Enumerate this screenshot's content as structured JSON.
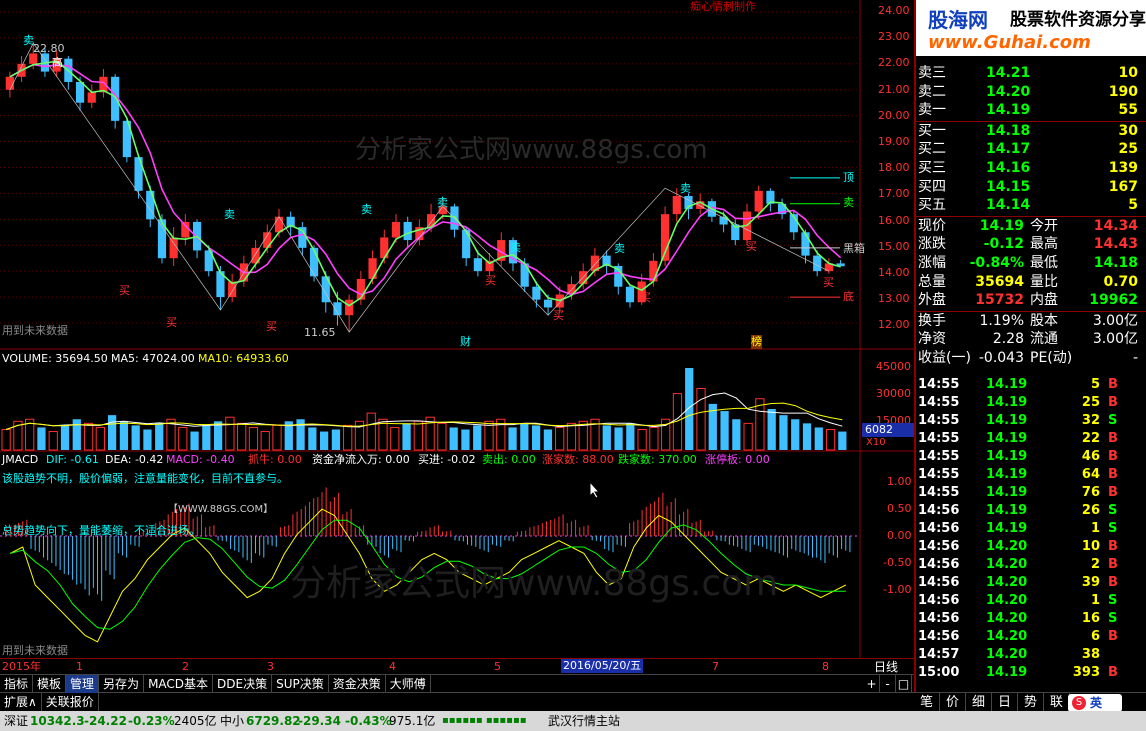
{
  "header": {
    "author_label": "痴心情刺制作",
    "badge_site": "股海网",
    "badge_tagline": "股票软件资源分享",
    "badge_url": "www.Guhai.com"
  },
  "main_chart": {
    "y_axis": [
      "24.00",
      "23.00",
      "22.00",
      "21.00",
      "20.00",
      "19.00",
      "18.00",
      "17.00",
      "16.00",
      "15.00",
      "14.00",
      "13.00",
      "12.00"
    ],
    "price_high_label": "22.80",
    "price_low_label": "11.65",
    "marker_high": "高",
    "watermark": "分析家公式网www.88gs.com",
    "future_data_note": "用到未来数据",
    "finance_mark": "财",
    "rank_mark": "榜",
    "sell_marker": "卖",
    "buy_marker": "买",
    "right_labels": [
      "顶",
      "卖",
      "黑箱",
      "底"
    ],
    "colors": {
      "up": "#ff3030",
      "down": "#3fbfff",
      "ma_green": "#66ff66",
      "ma_magenta": "#ff40ff"
    }
  },
  "candles": [
    {
      "o": 21.0,
      "c": 21.5,
      "h": 21.7,
      "l": 20.7
    },
    {
      "o": 21.5,
      "c": 22.0,
      "h": 22.3,
      "l": 21.3
    },
    {
      "o": 22.0,
      "c": 22.4,
      "h": 22.8,
      "l": 21.8
    },
    {
      "o": 22.4,
      "c": 21.7,
      "h": 22.6,
      "l": 21.5
    },
    {
      "o": 21.7,
      "c": 22.2,
      "h": 22.5,
      "l": 21.5
    },
    {
      "o": 22.2,
      "c": 21.3,
      "h": 22.3,
      "l": 21.0
    },
    {
      "o": 21.3,
      "c": 20.5,
      "h": 21.5,
      "l": 20.2
    },
    {
      "o": 20.5,
      "c": 20.9,
      "h": 21.2,
      "l": 20.3
    },
    {
      "o": 20.9,
      "c": 21.5,
      "h": 21.8,
      "l": 20.7
    },
    {
      "o": 21.5,
      "c": 19.8,
      "h": 21.6,
      "l": 19.5
    },
    {
      "o": 19.8,
      "c": 18.4,
      "h": 19.9,
      "l": 18.2
    },
    {
      "o": 18.4,
      "c": 17.1,
      "h": 18.5,
      "l": 16.8
    },
    {
      "o": 17.1,
      "c": 16.0,
      "h": 17.3,
      "l": 15.7
    },
    {
      "o": 16.0,
      "c": 14.5,
      "h": 16.2,
      "l": 14.3
    },
    {
      "o": 14.5,
      "c": 15.3,
      "h": 15.7,
      "l": 14.2
    },
    {
      "o": 15.3,
      "c": 15.9,
      "h": 16.2,
      "l": 15.0
    },
    {
      "o": 15.9,
      "c": 14.8,
      "h": 16.0,
      "l": 14.5
    },
    {
      "o": 14.8,
      "c": 14.0,
      "h": 15.0,
      "l": 13.8
    },
    {
      "o": 14.0,
      "c": 13.0,
      "h": 14.2,
      "l": 12.5
    },
    {
      "o": 13.0,
      "c": 13.6,
      "h": 13.9,
      "l": 12.8
    },
    {
      "o": 13.6,
      "c": 14.3,
      "h": 14.6,
      "l": 13.4
    },
    {
      "o": 14.3,
      "c": 14.9,
      "h": 15.2,
      "l": 14.1
    },
    {
      "o": 14.9,
      "c": 15.5,
      "h": 15.8,
      "l": 14.7
    },
    {
      "o": 15.5,
      "c": 16.1,
      "h": 16.4,
      "l": 15.3
    },
    {
      "o": 16.1,
      "c": 15.7,
      "h": 16.3,
      "l": 15.4
    },
    {
      "o": 15.7,
      "c": 14.9,
      "h": 15.9,
      "l": 14.6
    },
    {
      "o": 14.9,
      "c": 13.8,
      "h": 15.0,
      "l": 13.6
    },
    {
      "o": 13.8,
      "c": 12.8,
      "h": 14.0,
      "l": 12.4
    },
    {
      "o": 12.8,
      "c": 12.3,
      "h": 13.2,
      "l": 11.9
    },
    {
      "o": 12.3,
      "c": 12.9,
      "h": 13.1,
      "l": 11.65
    },
    {
      "o": 12.9,
      "c": 13.7,
      "h": 14.0,
      "l": 12.7
    },
    {
      "o": 13.7,
      "c": 14.5,
      "h": 14.8,
      "l": 13.5
    },
    {
      "o": 14.5,
      "c": 15.3,
      "h": 15.6,
      "l": 14.3
    },
    {
      "o": 15.3,
      "c": 15.9,
      "h": 16.2,
      "l": 15.1
    },
    {
      "o": 15.9,
      "c": 15.2,
      "h": 16.1,
      "l": 14.9
    },
    {
      "o": 15.2,
      "c": 15.7,
      "h": 16.0,
      "l": 15.0
    },
    {
      "o": 15.7,
      "c": 16.2,
      "h": 16.6,
      "l": 15.5
    },
    {
      "o": 16.2,
      "c": 16.5,
      "h": 16.8,
      "l": 16.0
    },
    {
      "o": 16.5,
      "c": 15.6,
      "h": 16.6,
      "l": 15.3
    },
    {
      "o": 15.6,
      "c": 14.5,
      "h": 15.7,
      "l": 14.2
    },
    {
      "o": 14.5,
      "c": 14.0,
      "h": 14.8,
      "l": 13.8
    },
    {
      "o": 14.0,
      "c": 14.4,
      "h": 14.7,
      "l": 13.8
    },
    {
      "o": 14.4,
      "c": 15.2,
      "h": 15.5,
      "l": 14.2
    },
    {
      "o": 15.2,
      "c": 14.3,
      "h": 15.3,
      "l": 14.0
    },
    {
      "o": 14.3,
      "c": 13.4,
      "h": 14.5,
      "l": 13.2
    },
    {
      "o": 13.4,
      "c": 12.9,
      "h": 13.6,
      "l": 12.6
    },
    {
      "o": 12.9,
      "c": 12.6,
      "h": 13.1,
      "l": 12.3
    },
    {
      "o": 12.6,
      "c": 13.1,
      "h": 13.4,
      "l": 12.4
    },
    {
      "o": 13.1,
      "c": 13.5,
      "h": 13.8,
      "l": 12.9
    },
    {
      "o": 13.5,
      "c": 14.0,
      "h": 14.3,
      "l": 13.3
    },
    {
      "o": 14.0,
      "c": 14.6,
      "h": 14.9,
      "l": 13.8
    },
    {
      "o": 14.6,
      "c": 14.2,
      "h": 14.8,
      "l": 13.9
    },
    {
      "o": 14.2,
      "c": 13.4,
      "h": 14.3,
      "l": 13.1
    },
    {
      "o": 13.4,
      "c": 12.8,
      "h": 13.5,
      "l": 12.6
    },
    {
      "o": 12.8,
      "c": 13.6,
      "h": 13.9,
      "l": 12.7
    },
    {
      "o": 13.6,
      "c": 14.4,
      "h": 14.7,
      "l": 13.4
    },
    {
      "o": 14.4,
      "c": 16.2,
      "h": 16.5,
      "l": 14.2
    },
    {
      "o": 16.2,
      "c": 16.9,
      "h": 17.2,
      "l": 15.9
    },
    {
      "o": 16.9,
      "c": 16.4,
      "h": 17.0,
      "l": 16.0
    },
    {
      "o": 16.4,
      "c": 16.7,
      "h": 17.0,
      "l": 16.2
    },
    {
      "o": 16.7,
      "c": 16.1,
      "h": 16.8,
      "l": 15.9
    },
    {
      "o": 16.1,
      "c": 15.8,
      "h": 16.3,
      "l": 15.5
    },
    {
      "o": 15.8,
      "c": 15.2,
      "h": 16.0,
      "l": 15.0
    },
    {
      "o": 15.2,
      "c": 16.3,
      "h": 16.6,
      "l": 15.0
    },
    {
      "o": 16.3,
      "c": 17.1,
      "h": 17.3,
      "l": 16.0
    },
    {
      "o": 17.1,
      "c": 16.6,
      "h": 17.2,
      "l": 16.3
    },
    {
      "o": 16.6,
      "c": 16.2,
      "h": 16.8,
      "l": 16.0
    },
    {
      "o": 16.2,
      "c": 15.5,
      "h": 16.3,
      "l": 15.2
    },
    {
      "o": 15.5,
      "c": 14.6,
      "h": 15.6,
      "l": 14.3
    },
    {
      "o": 14.6,
      "c": 14.0,
      "h": 14.8,
      "l": 13.8
    },
    {
      "o": 14.0,
      "c": 14.3,
      "h": 14.5,
      "l": 13.9
    },
    {
      "o": 14.3,
      "c": 14.19,
      "h": 14.43,
      "l": 14.18
    }
  ],
  "volume_panel": {
    "label_volume": "VOLUME: 35694.50",
    "label_ma5": "MA5: 47024.00",
    "label_ma10": "MA10: 64933.60",
    "y_axis": [
      "45000",
      "30000",
      "15000"
    ],
    "unit": "X10",
    "current_box": "6082",
    "values": [
      20,
      28,
      30,
      22,
      18,
      24,
      30,
      26,
      22,
      34,
      28,
      24,
      20,
      26,
      30,
      22,
      18,
      24,
      28,
      32,
      26,
      22,
      18,
      24,
      28,
      30,
      22,
      18,
      20,
      24,
      28,
      36,
      30,
      22,
      26,
      28,
      32,
      26,
      22,
      20,
      24,
      28,
      30,
      22,
      26,
      24,
      20,
      22,
      26,
      28,
      30,
      24,
      22,
      26,
      20,
      22,
      30,
      55,
      80,
      60,
      45,
      38,
      30,
      26,
      50,
      40,
      34,
      30,
      26,
      22,
      20,
      18
    ]
  },
  "macd_panel": {
    "label_name": "JMACD",
    "label_dif": "DIF: -0.61",
    "label_dea": "DEA: -0.42",
    "label_macd": "MACD: -0.40",
    "label_zhuaniu": "抓牛: 0.00",
    "label_fund": "资金净流入万: 0.00",
    "label_buyin": "买进: -0.02",
    "label_sellout": "卖出: 0.00",
    "label_zhangjia": "涨家数: 88.00",
    "label_diejia": "跌家数: 370.00",
    "label_zhangting": "涨停板: 0.00",
    "advice_1": "该股趋势不明，股价偏弱，注意量能变化，目前不直参与。",
    "advice_2": "总势趋势向下，量能萎缩，不适合进场。",
    "site_tag": "【WWW.88GS.COM】",
    "watermark": "分析家公式网www.88gs.com",
    "future_data_note": "用到未来数据",
    "y_axis": [
      "1.00",
      "0.50",
      "0.00",
      "-0.50",
      "-1.00"
    ],
    "bars": [
      0.2,
      0.3,
      -0.3,
      -0.5,
      -0.7,
      -0.9,
      -1.1,
      -1.2,
      -0.8,
      -0.4,
      -0.2,
      0.1,
      0.3,
      0.5,
      0.6,
      0.4,
      0.2,
      -0.1,
      -0.3,
      -0.5,
      -0.4,
      -0.2,
      0.2,
      0.5,
      0.7,
      0.9,
      0.8,
      0.5,
      0.2,
      -0.2,
      -0.4,
      -0.3,
      -0.1,
      0.1,
      0.2,
      0.1,
      -0.1,
      -0.2,
      -0.3,
      -0.2,
      -0.1,
      0.1,
      0.2,
      0.3,
      0.4,
      0.3,
      0.2,
      -0.1,
      -0.3,
      -0.2,
      0.3,
      0.6,
      0.8,
      0.7,
      0.5,
      0.3,
      0.1,
      -0.1,
      -0.2,
      -0.3,
      -0.2,
      -0.3,
      -0.4,
      -0.3,
      -0.4,
      -0.5,
      -0.4,
      -0.3
    ]
  },
  "date_axis": {
    "year": "2015年",
    "months": [
      "1",
      "2",
      "3",
      "4",
      "5",
      "6",
      "7",
      "8"
    ],
    "cursor_date": "2016/05/20/五",
    "period": "日线"
  },
  "bottom_tabs": [
    {
      "label": "指标"
    },
    {
      "label": "模板"
    },
    {
      "label": "管理",
      "active": true
    },
    {
      "label": "另存为"
    },
    {
      "label": "MACD基本"
    },
    {
      "label": "DDE决策"
    },
    {
      "label": "SUP决策"
    },
    {
      "label": "资金决策"
    },
    {
      "label": "大师傅"
    }
  ],
  "sub_tabs": [
    {
      "label": "扩展∧"
    },
    {
      "label": "关联报价"
    }
  ],
  "nav_buttons": [
    "+",
    "-",
    "□"
  ],
  "quote": {
    "asks": [
      {
        "label": "卖三",
        "price": "14.21",
        "vol": "10"
      },
      {
        "label": "卖二",
        "price": "14.20",
        "vol": "190"
      },
      {
        "label": "卖一",
        "price": "14.19",
        "vol": "55"
      }
    ],
    "bids": [
      {
        "label": "买一",
        "price": "14.18",
        "vol": "30"
      },
      {
        "label": "买二",
        "price": "14.17",
        "vol": "25"
      },
      {
        "label": "买三",
        "price": "14.16",
        "vol": "139"
      },
      {
        "label": "买四",
        "price": "14.15",
        "vol": "167"
      },
      {
        "label": "买五",
        "price": "14.14",
        "vol": "5"
      }
    ],
    "stats": [
      {
        "l1": "现价",
        "v1": "14.19",
        "l2": "今开",
        "v2": "14.34",
        "c1": "#00ff00",
        "c2": "#ff3030"
      },
      {
        "l1": "涨跌",
        "v1": "-0.12",
        "l2": "最高",
        "v2": "14.43",
        "c1": "#00ff00",
        "c2": "#ff3030"
      },
      {
        "l1": "涨幅",
        "v1": "-0.84%",
        "l2": "最低",
        "v2": "14.18",
        "c1": "#00ff00",
        "c2": "#00ff00"
      },
      {
        "l1": "总量",
        "v1": "35694",
        "l2": "量比",
        "v2": "0.70",
        "c1": "#ffff00",
        "c2": "#ffff00"
      },
      {
        "l1": "外盘",
        "v1": "15732",
        "l2": "内盘",
        "v2": "19962",
        "c1": "#ff3030",
        "c2": "#00ff00"
      }
    ],
    "stats2": [
      {
        "l1": "换手",
        "v1": "1.19%",
        "l2": "股本",
        "v2": "3.00亿"
      },
      {
        "l1": "净资",
        "v1": "2.28",
        "l2": "流通",
        "v2": "3.00亿"
      },
      {
        "l1": "收益(一)",
        "v1": "-0.043",
        "l2": "PE(动)",
        "v2": "-"
      }
    ]
  },
  "ticks": [
    {
      "t": "14:55",
      "p": "14.19",
      "v": "5",
      "s": "B"
    },
    {
      "t": "14:55",
      "p": "14.19",
      "v": "25",
      "s": "B"
    },
    {
      "t": "14:55",
      "p": "14.19",
      "v": "32",
      "s": "S"
    },
    {
      "t": "14:55",
      "p": "14.19",
      "v": "22",
      "s": "B"
    },
    {
      "t": "14:55",
      "p": "14.19",
      "v": "46",
      "s": "B"
    },
    {
      "t": "14:55",
      "p": "14.19",
      "v": "64",
      "s": "B"
    },
    {
      "t": "14:55",
      "p": "14.19",
      "v": "76",
      "s": "B"
    },
    {
      "t": "14:56",
      "p": "14.19",
      "v": "26",
      "s": "S"
    },
    {
      "t": "14:56",
      "p": "14.19",
      "v": "1",
      "s": "S"
    },
    {
      "t": "14:56",
      "p": "14.20",
      "v": "10",
      "s": "B"
    },
    {
      "t": "14:56",
      "p": "14.20",
      "v": "2",
      "s": "B"
    },
    {
      "t": "14:56",
      "p": "14.20",
      "v": "39",
      "s": "B"
    },
    {
      "t": "14:56",
      "p": "14.20",
      "v": "1",
      "s": "S"
    },
    {
      "t": "14:56",
      "p": "14.20",
      "v": "16",
      "s": "S"
    },
    {
      "t": "14:56",
      "p": "14.20",
      "v": "6",
      "s": "B"
    },
    {
      "t": "14:57",
      "p": "14.20",
      "v": "38",
      "s": ""
    },
    {
      "t": "15:00",
      "p": "14.19",
      "v": "393",
      "s": "B"
    }
  ],
  "right_tabs": [
    "笔",
    "价",
    "细",
    "日",
    "势",
    "联"
  ],
  "status_bar": {
    "sz_label": "深证",
    "sz_value": "10342.3",
    "sz_change": "-24.22",
    "sz_pct": "-0.23%",
    "sz_amount": "2405亿",
    "zx_label": "中小",
    "zx_value": "6729.82",
    "zx_change": "-29.34",
    "zx_pct": "-0.43%",
    "zx_amount": "975.1亿",
    "signal": "▪▪▪▪▪▪ ▪▪▪▪▪▪",
    "server": "武汉行情主站",
    "ime": "英"
  }
}
